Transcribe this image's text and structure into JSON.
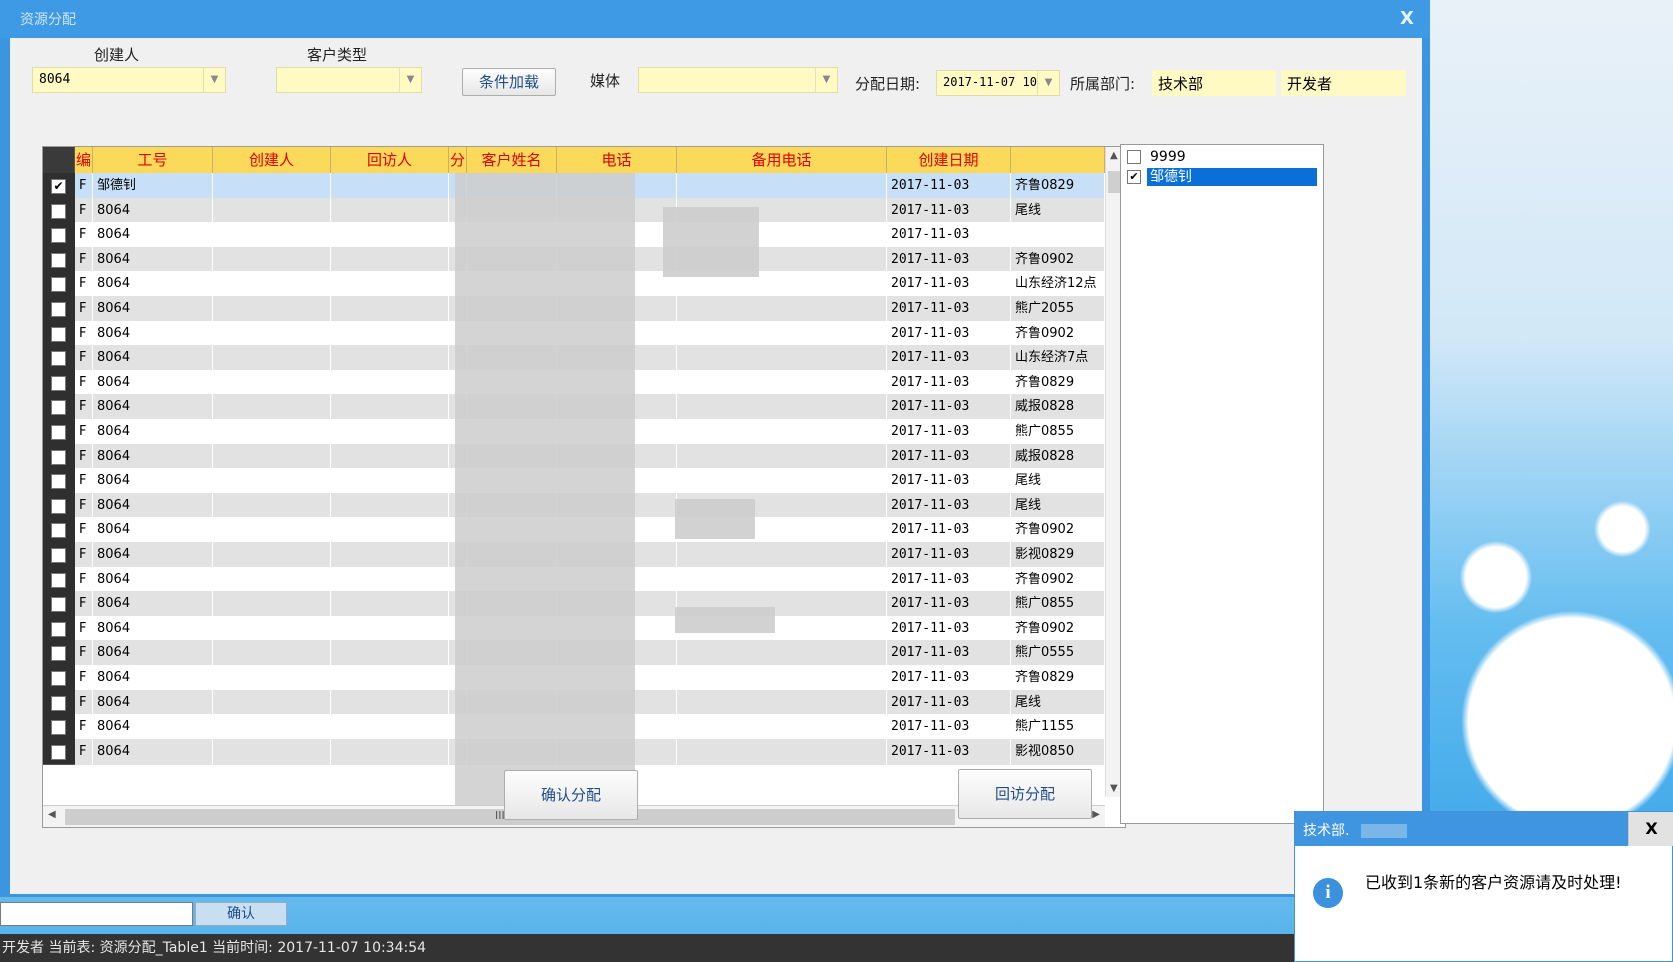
{
  "window": {
    "title": "资源分配",
    "close": "X"
  },
  "filters": {
    "creator_label": "创建人",
    "creator_value": "8064",
    "customer_type_label": "客户类型",
    "customer_type_value": "",
    "load_button": "条件加载",
    "media_label": "媒体",
    "media_value": "",
    "assign_date_label": "分配日期:",
    "assign_date_value": "2017-11-07 10",
    "department_label": "所属部门:",
    "department_value": "技术部",
    "role_value": "开发者"
  },
  "grid": {
    "columns": [
      "编",
      "工号",
      "创建人",
      "回访人",
      "分",
      "客户姓名",
      "电话",
      "备用电话",
      "创建日期",
      ""
    ],
    "rows": [
      {
        "checked": true,
        "f": "F",
        "id": "邹德钊",
        "date": "2017-11-03",
        "media": "齐鲁0829"
      },
      {
        "checked": false,
        "f": "F",
        "id": "8064",
        "date": "2017-11-03",
        "media": "尾线"
      },
      {
        "checked": false,
        "f": "F",
        "id": "8064",
        "date": "2017-11-03",
        "media": ""
      },
      {
        "checked": false,
        "f": "F",
        "id": "8064",
        "date": "2017-11-03",
        "media": "齐鲁0902"
      },
      {
        "checked": false,
        "f": "F",
        "id": "8064",
        "date": "2017-11-03",
        "media": "山东经济12点"
      },
      {
        "checked": false,
        "f": "F",
        "id": "8064",
        "date": "2017-11-03",
        "media": "熊广2055"
      },
      {
        "checked": false,
        "f": "F",
        "id": "8064",
        "date": "2017-11-03",
        "media": "齐鲁0902"
      },
      {
        "checked": false,
        "f": "F",
        "id": "8064",
        "date": "2017-11-03",
        "media": "山东经济7点"
      },
      {
        "checked": false,
        "f": "F",
        "id": "8064",
        "date": "2017-11-03",
        "media": "齐鲁0829"
      },
      {
        "checked": false,
        "f": "F",
        "id": "8064",
        "date": "2017-11-03",
        "media": "威报0828"
      },
      {
        "checked": false,
        "f": "F",
        "id": "8064",
        "date": "2017-11-03",
        "media": "熊广0855"
      },
      {
        "checked": false,
        "f": "F",
        "id": "8064",
        "date": "2017-11-03",
        "media": "威报0828"
      },
      {
        "checked": false,
        "f": "F",
        "id": "8064",
        "date": "2017-11-03",
        "media": "尾线"
      },
      {
        "checked": false,
        "f": "F",
        "id": "8064",
        "date": "2017-11-03",
        "media": "尾线"
      },
      {
        "checked": false,
        "f": "F",
        "id": "8064",
        "date": "2017-11-03",
        "media": "齐鲁0902"
      },
      {
        "checked": false,
        "f": "F",
        "id": "8064",
        "date": "2017-11-03",
        "media": "影视0829"
      },
      {
        "checked": false,
        "f": "F",
        "id": "8064",
        "date": "2017-11-03",
        "media": "齐鲁0902"
      },
      {
        "checked": false,
        "f": "F",
        "id": "8064",
        "date": "2017-11-03",
        "media": "熊广0855"
      },
      {
        "checked": false,
        "f": "F",
        "id": "8064",
        "date": "2017-11-03",
        "media": "齐鲁0902"
      },
      {
        "checked": false,
        "f": "F",
        "id": "8064",
        "date": "2017-11-03",
        "media": "熊广0555"
      },
      {
        "checked": false,
        "f": "F",
        "id": "8064",
        "date": "2017-11-03",
        "media": "齐鲁0829"
      },
      {
        "checked": false,
        "f": "F",
        "id": "8064",
        "date": "2017-11-03",
        "media": "尾线"
      },
      {
        "checked": false,
        "f": "F",
        "id": "8064",
        "date": "2017-11-03",
        "media": "熊广1155"
      },
      {
        "checked": false,
        "f": "F",
        "id": "8064",
        "date": "2017-11-03",
        "media": "影视0850"
      }
    ],
    "scroll_grip": "III"
  },
  "user_list": [
    {
      "label": "9999",
      "checked": false,
      "selected": false
    },
    {
      "label": "邹德钊",
      "checked": true,
      "selected": true
    }
  ],
  "actions": {
    "confirm_assign": "确认分配",
    "revisit_assign": "回访分配"
  },
  "bottom": {
    "input_value": "",
    "confirm": "确认"
  },
  "status": {
    "text": "开发者 当前表: 资源分配_Table1 当前时间: 2017-11-07 10:34:54"
  },
  "notification": {
    "title": "技术部.",
    "close": "X",
    "icon": "info-icon",
    "message": "已收到1条新的客户资源请及时处理!"
  },
  "colors": {
    "header_bg": "#fbd95a",
    "header_text": "#e00000",
    "titlebar": "#3f9ae6",
    "input_bg": "#fff9c4",
    "selected": "#0a6fd6"
  }
}
